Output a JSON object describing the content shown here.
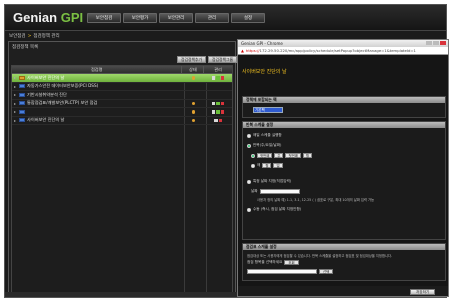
{
  "app": {
    "logo_main": "Genian",
    "logo_accent": "GPI",
    "nav": [
      "보안점검",
      "보안평가",
      "보안관리",
      "관리",
      "설정"
    ]
  },
  "breadcrumb": {
    "home": "보안점검",
    "separator": ">",
    "current": "점검정책 관리"
  },
  "panel": {
    "title": "점검정책 목록",
    "add_button": "점검정책추가",
    "add_group_button": "점검정책그룹",
    "columns": [
      "점검명",
      "상태",
      "관리"
    ],
    "rows": [
      {
        "label": "사이버보안 진단의 날",
        "selected": true,
        "folder": "orange",
        "state": true,
        "actions": [
          "edit",
          "add",
          "del"
        ]
      },
      {
        "label": "자동가스안전 데이터보안보증(PCI DSS)",
        "selected": false,
        "folder": "blue",
        "state": false,
        "actions": []
      },
      {
        "label": "기반시설취약분석 진단",
        "selected": false,
        "folder": "blue",
        "state": false,
        "actions": []
      },
      {
        "label": "통합점검표/개발보안(PLCTP) 보안 점검",
        "selected": false,
        "folder": "blue",
        "state": true,
        "actions": [
          "edit",
          "add",
          "del"
        ]
      },
      {
        "label": "",
        "selected": false,
        "folder": "blue",
        "state": true,
        "actions": [
          "edit",
          "add",
          "del"
        ]
      },
      {
        "label": "사이버보안 진단의 날",
        "selected": false,
        "folder": "blue",
        "state": true,
        "actions": [
          "edit",
          "del"
        ]
      }
    ]
  },
  "popup": {
    "window_title": "Genian GPI - Chrome",
    "url_proto": "https://",
    "url_rest": "172.29.50.220/mc/app/policy/schedule/setPopup?objectManage=1&templateId=1",
    "title": "사이버보안 진단의 날",
    "section1_head": "정책에 포함되는 팩",
    "section1_combo": "기본팩",
    "section2_head": "반복 스케줄 설정",
    "opt_daily": "매일 스케줄 실행함",
    "opt_weekly": "반복(주/요일/날짜)",
    "weekly_sel1": "첫번째",
    "weekly_sel2": "주",
    "weekly_sel3": "첫번째",
    "weekly_sel4": "월",
    "opt_month_prefix": "매",
    "month_sel1": "월",
    "month_sel2": "일",
    "opt_custom": "특정 날짜 지정(직접입력)",
    "custom_label": "날짜",
    "custom_note": "사용자 정의 날짜 예) 1-1, 3-1, 12-25 (  ) 쉼표로 구분, 최대 10개의 날짜 입력 가능",
    "opt_now": "수동 (즉시, 점검 날짜 지정안함)",
    "section3_head": "점검표 스케줄 설정",
    "sec3_text": "점검대상 또는 사용자에게 점검할 수 있습니다. 반복 스케줄을 설정하고 점검표 및 점검대상을 지정합니다.",
    "sec3_text2": "점검 항목을 선택하세요",
    "sec3_btn": "조회",
    "sec3_btn2": "선택",
    "footer_btn": "저장하기"
  }
}
